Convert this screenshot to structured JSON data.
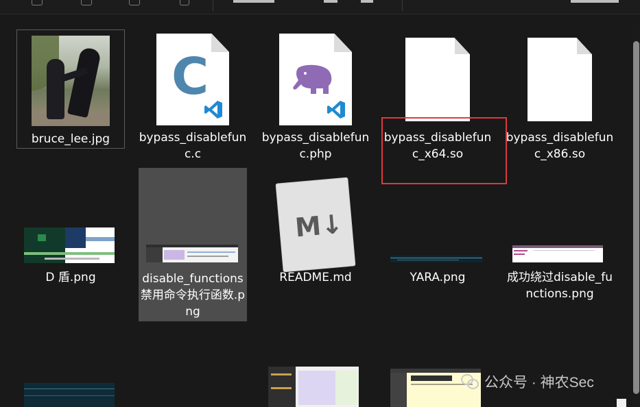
{
  "files": [
    {
      "name": "bruce_lee.jpg",
      "type": "image-photo"
    },
    {
      "name": "bypass_disablefunc.c",
      "type": "c-source"
    },
    {
      "name": "bypass_disablefunc.php",
      "type": "php-source"
    },
    {
      "name": "bypass_disablefunc_x64.so",
      "type": "generic-file"
    },
    {
      "name": "bypass_disablefunc_x86.so",
      "type": "generic-file"
    },
    {
      "name": "D 盾.png",
      "type": "screenshot"
    },
    {
      "name": "disable_functions 禁用命令执行函数.png",
      "type": "screenshot"
    },
    {
      "name": "README.md",
      "type": "markdown"
    },
    {
      "name": "YARA.png",
      "type": "screenshot"
    },
    {
      "name": "成功绕过disable_functions.png",
      "type": "screenshot"
    }
  ],
  "watermark": {
    "text": "公众号 · 神农Sec",
    "icon": "wechat-icon"
  },
  "colors": {
    "background": "#191919",
    "selected_tile": "#4d4d4d",
    "highlight_box": "#e0393e",
    "c_icon": "#4f86ad",
    "php_icon": "#8f6bb5",
    "vscode_badge": "#1f8ad2"
  }
}
